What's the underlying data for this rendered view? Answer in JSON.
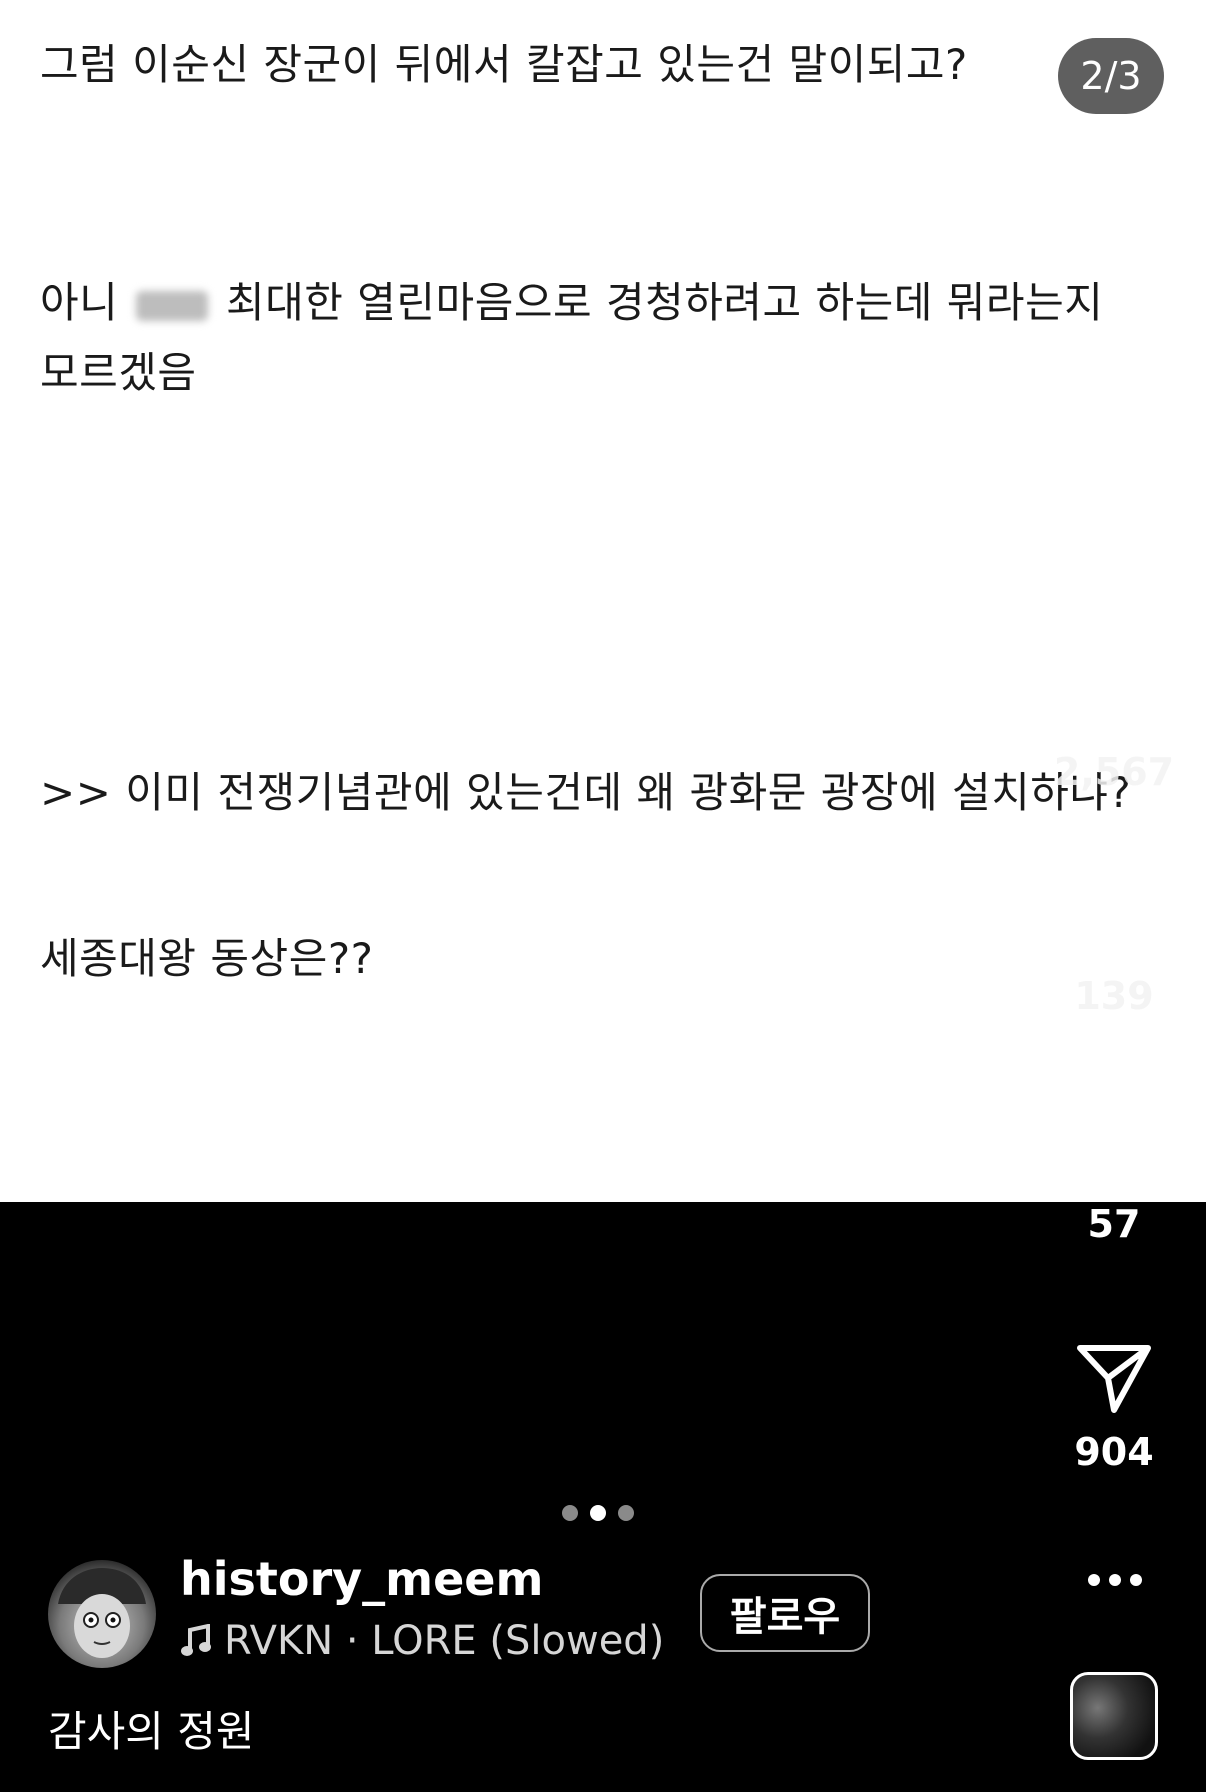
{
  "post": {
    "lines": [
      "그럼 이순신 장군이 뒤에서 칼잡고 있는건 말이되고?",
      "아니",
      "최대한 열린마음으로 경청하려고 하는데 뭐라는지",
      "모르겠음",
      ">> 이미 전쟁기념관에 있는건데 왜 광화문 광장에 설치하냐?",
      "세종대왕 동상은??"
    ]
  },
  "page_indicator": "2/3",
  "actions": {
    "likes": "2,567",
    "comments": "139",
    "reposts": "57",
    "shares": "904"
  },
  "author": {
    "username": "history_meem",
    "music": "RVKN · LORE (Slowed)",
    "follow_label": "팔로우"
  },
  "caption": "감사의 정원",
  "colors": {
    "background": "#000000",
    "post_bg": "#ffffff",
    "text_dark": "#1a1a1a",
    "indicator_bg": "#5f5f5f"
  },
  "icons": [
    "heart-icon",
    "comment-icon",
    "repost-icon",
    "send-icon",
    "music-note-icon",
    "more-icon"
  ]
}
